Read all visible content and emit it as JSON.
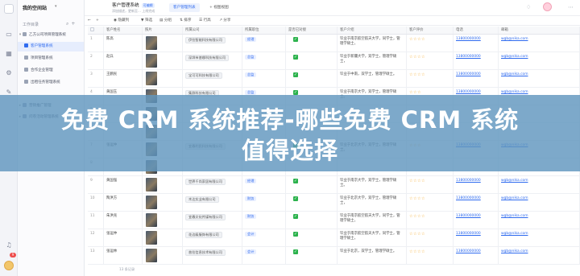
{
  "workspace": {
    "title": "我的空间站",
    "dir_title": "工作目录"
  },
  "sidebar": {
    "items": [
      {
        "label": "乙方公司项目管理系统",
        "level": 0,
        "active": false
      },
      {
        "label": "客户管理系统",
        "level": 1,
        "active": true
      },
      {
        "label": "项目管理系统",
        "level": 1,
        "active": false
      },
      {
        "label": "合作企业管理",
        "level": 1,
        "active": false
      },
      {
        "label": "出租任务管理系统",
        "level": 1,
        "active": false
      },
      {
        "label": "营销推广管理",
        "level": 0,
        "active": false
      },
      {
        "label": "问卷活动管理系统",
        "level": 0,
        "active": false
      }
    ]
  },
  "header": {
    "app_name": "客户管理系统",
    "app_tag": "可编辑",
    "app_sub": "添加描述，更新至… 上线完成",
    "tabs": [
      {
        "label": "客户管理列表",
        "active": true
      },
      {
        "label": "+ 视图视图",
        "active": false
      }
    ]
  },
  "toolbar": {
    "items": [
      "◉ 隐藏列",
      "▼ 筛选",
      "▤ 分组",
      "⇅ 排序",
      "☰ 行高",
      "↗ 分享"
    ]
  },
  "table": {
    "columns": [
      "",
      "客户姓名",
      "照片",
      "所属公司",
      "所属职位",
      "是否已对接",
      "客户介绍",
      "客户评价",
      "电话",
      "邮箱"
    ],
    "rows": [
      {
        "num": "1",
        "name": "陈高",
        "company": "伊拉智能科技有限公司",
        "position": "经理",
        "connected": true,
        "intro": "毕业于南京航空航天大学，同学士，管理学硕士，",
        "rating": "☆☆☆☆",
        "phone": "13800000000",
        "email": "wgb@nika.com"
      },
      {
        "num": "2",
        "name": "赵兵",
        "company": "深圳市普娜科技有限公司",
        "position": "总监",
        "connected": true,
        "intro": "毕业于新疆大学，双学士，管理学硕士，",
        "rating": "☆☆☆☆",
        "phone": "13800000000",
        "email": "wgb@nika.com"
      },
      {
        "num": "3",
        "name": "王鹏民",
        "company": "宝可可科技有限公司",
        "position": "总监",
        "connected": true,
        "intro": "毕业于中南，双学士，管理学硕士。",
        "rating": "☆☆☆☆",
        "phone": "13800000000",
        "email": "wgb@nika.com"
      },
      {
        "num": "4",
        "name": "黄国玉",
        "company": "集群科技有限公司",
        "position": "总监",
        "connected": true,
        "intro": "毕业于南京大学，双学士，管理学硕士。",
        "rating": "☆☆☆",
        "phone": "13800000000",
        "email": "wgb@nika.com"
      },
      {
        "num": "5",
        "name": "",
        "company": "",
        "position": "",
        "connected": false,
        "intro": "",
        "rating": "",
        "phone": "",
        "email": ""
      },
      {
        "num": "6",
        "name": "",
        "company": "",
        "position": "",
        "connected": false,
        "intro": "",
        "rating": "",
        "phone": "",
        "email": ""
      },
      {
        "num": "7",
        "name": "张运仲",
        "company": "宜春利民科技有限公司",
        "position": "总监",
        "connected": true,
        "intro": "毕业于北京大学，双学士，管理学硕士。",
        "rating": "☆☆☆",
        "phone": "13800000000",
        "email": "wgb@nika.com"
      },
      {
        "num": "8",
        "name": "",
        "company": "",
        "position": "",
        "connected": false,
        "intro": "",
        "rating": "",
        "phone": "",
        "email": ""
      },
      {
        "num": "9",
        "name": "黄国强",
        "company": "世界千尚家居有限公司",
        "position": "经理",
        "connected": true,
        "intro": "毕业于南京大学，双学士，管理学硕士。",
        "rating": "☆☆☆☆",
        "phone": "13800000000",
        "email": "wgb@nika.com"
      },
      {
        "num": "10",
        "name": "陶洪方",
        "company": "木达实业有限公司",
        "position": "财务",
        "connected": true,
        "intro": "毕业于北京大学，双学士，管理学硕士，",
        "rating": "☆☆☆☆",
        "phone": "13800000000",
        "email": "wgb@nika.com"
      },
      {
        "num": "11",
        "name": "朱洪兆",
        "company": "宜春文化传媒有限公司",
        "position": "财务",
        "connected": true,
        "intro": "毕业于南京航空航天大学，同学士，管理学硕士，",
        "rating": "☆☆☆☆",
        "phone": "13800000000",
        "email": "wgb@nika.com"
      },
      {
        "num": "12",
        "name": "张运仲",
        "company": "花边级服饰有限公司",
        "position": "会计",
        "connected": true,
        "intro": "毕业于南京航空航天大学，同学士，管理学硕士，",
        "rating": "☆☆☆☆",
        "phone": "13800000000",
        "email": "wgb@nika.com"
      },
      {
        "num": "13",
        "name": "张运林",
        "company": "普拉信息技术有限公司",
        "position": "会计",
        "connected": true,
        "intro": "毕业于北京，双学士，管理学硕士。",
        "rating": "☆☆☆☆",
        "phone": "13800000000",
        "email": "wgb@nika.com"
      }
    ],
    "footer_count": "13 条记录"
  },
  "watermark": {
    "line1": "免费 CRM 系统推荐-哪些免费 CRM 系统",
    "line2": "值得选择"
  },
  "colors": {
    "accent": "#2f6bef",
    "banner": "#6096be",
    "check": "#2bb24c",
    "star": "#f5a623"
  }
}
